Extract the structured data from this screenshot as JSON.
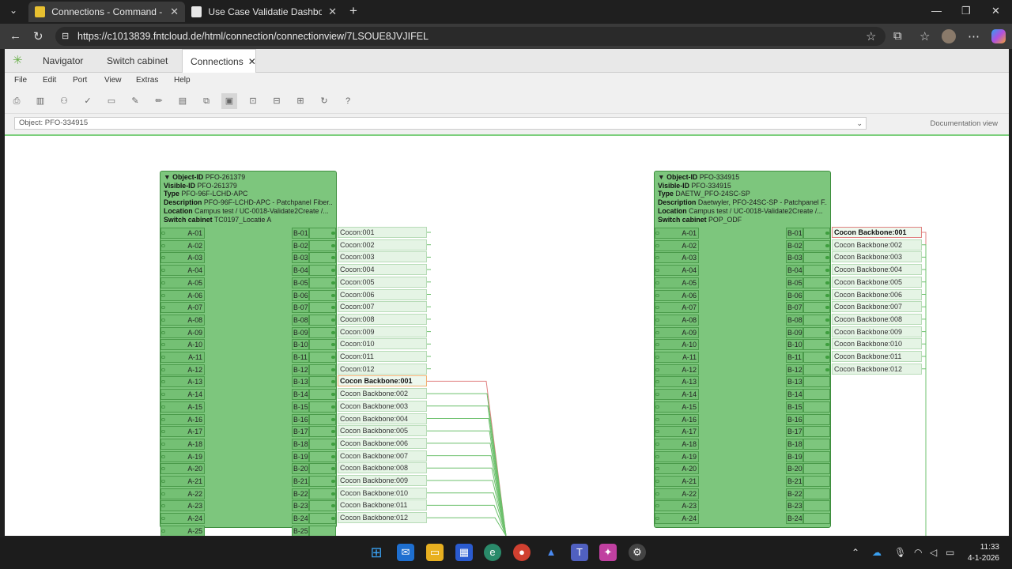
{
  "browser": {
    "tabs": [
      {
        "title": "Connections - Command - FNT G",
        "active": true
      },
      {
        "title": "Use Case Validatie Dashboard | R",
        "active": false
      }
    ],
    "url": "https://c1013839.fntcloud.de/html/connection/connectionview/7LSOUE8JVJIFEL"
  },
  "app": {
    "tabs": [
      "Navigator",
      "Switch cabinet",
      "Connections"
    ],
    "menu": [
      "File",
      "Edit",
      "Port",
      "View",
      "Extras",
      "Help"
    ],
    "object_selector": "Object: PFO-334915",
    "doc_view": "Documentation view"
  },
  "panels": [
    {
      "object_id": "PFO-261379",
      "visible_id": "PFO-261379",
      "type": "PFO-96F-LCHD-APC",
      "description": "PFO-96F-LCHD-APC - Patchpanel Fiber...",
      "location": "Campus test / UC-0018-Validate2Create /...",
      "switch_cabinet": "TC0197_Locatie A",
      "a_ports": [
        "A-01",
        "A-02",
        "A-03",
        "A-04",
        "A-05",
        "A-06",
        "A-07",
        "A-08",
        "A-09",
        "A-10",
        "A-11",
        "A-12",
        "A-13",
        "A-14",
        "A-15",
        "A-16",
        "A-17",
        "A-18",
        "A-19",
        "A-20",
        "A-21",
        "A-22",
        "A-23",
        "A-24",
        "A-25"
      ],
      "b_ports": [
        "B-01",
        "B-02",
        "B-03",
        "B-04",
        "B-05",
        "B-06",
        "B-07",
        "B-08",
        "B-09",
        "B-10",
        "B-11",
        "B-12",
        "B-13",
        "B-14",
        "B-15",
        "B-16",
        "B-17",
        "B-18",
        "B-19",
        "B-20",
        "B-21",
        "B-22",
        "B-23",
        "B-24",
        "B-25"
      ],
      "connections": [
        "Cocon:001",
        "Cocon:002",
        "Cocon:003",
        "Cocon:004",
        "Cocon:005",
        "Cocon:006",
        "Cocon:007",
        "Cocon:008",
        "Cocon:009",
        "Cocon:010",
        "Cocon:011",
        "Cocon:012",
        "Cocon Backbone:001",
        "Cocon Backbone:002",
        "Cocon Backbone:003",
        "Cocon Backbone:004",
        "Cocon Backbone:005",
        "Cocon Backbone:006",
        "Cocon Backbone:007",
        "Cocon Backbone:008",
        "Cocon Backbone:009",
        "Cocon Backbone:010",
        "Cocon Backbone:011",
        "Cocon Backbone:012"
      ]
    },
    {
      "object_id": "PFO-334915",
      "visible_id": "PFO-334915",
      "type": "DAETW_PFO-24SC-SP",
      "description": "Daetwyler, PFO-24SC-SP - Patchpanel F...",
      "location": "Campus test / UC-0018-Validate2Create /...",
      "switch_cabinet": "POP_ODF",
      "a_ports": [
        "A-01",
        "A-02",
        "A-03",
        "A-04",
        "A-05",
        "A-06",
        "A-07",
        "A-08",
        "A-09",
        "A-10",
        "A-11",
        "A-12",
        "A-13",
        "A-14",
        "A-15",
        "A-16",
        "A-17",
        "A-18",
        "A-19",
        "A-20",
        "A-21",
        "A-22",
        "A-23",
        "A-24"
      ],
      "b_ports": [
        "B-01",
        "B-02",
        "B-03",
        "B-04",
        "B-05",
        "B-06",
        "B-07",
        "B-08",
        "B-09",
        "B-10",
        "B-11",
        "B-12",
        "B-13",
        "B-14",
        "B-15",
        "B-16",
        "B-17",
        "B-18",
        "B-19",
        "B-20",
        "B-21",
        "B-22",
        "B-23",
        "B-24"
      ],
      "connections": [
        "Cocon Backbone:001",
        "Cocon Backbone:002",
        "Cocon Backbone:003",
        "Cocon Backbone:004",
        "Cocon Backbone:005",
        "Cocon Backbone:006",
        "Cocon Backbone:007",
        "Cocon Backbone:008",
        "Cocon Backbone:009",
        "Cocon Backbone:010",
        "Cocon Backbone:011",
        "Cocon Backbone:012"
      ]
    }
  ],
  "labels": {
    "object_id": "Object-ID",
    "visible_id": "Visible-ID",
    "type": "Type",
    "description": "Description",
    "location": "Location",
    "switch_cabinet": "Switch cabinet"
  },
  "taskbar": {
    "time": "11:33",
    "date": "4-1-2026"
  },
  "colors": {
    "panel_green": "#7dc67d",
    "connection_bg": "#e5f4e5",
    "highlight_red": "#e08080"
  }
}
